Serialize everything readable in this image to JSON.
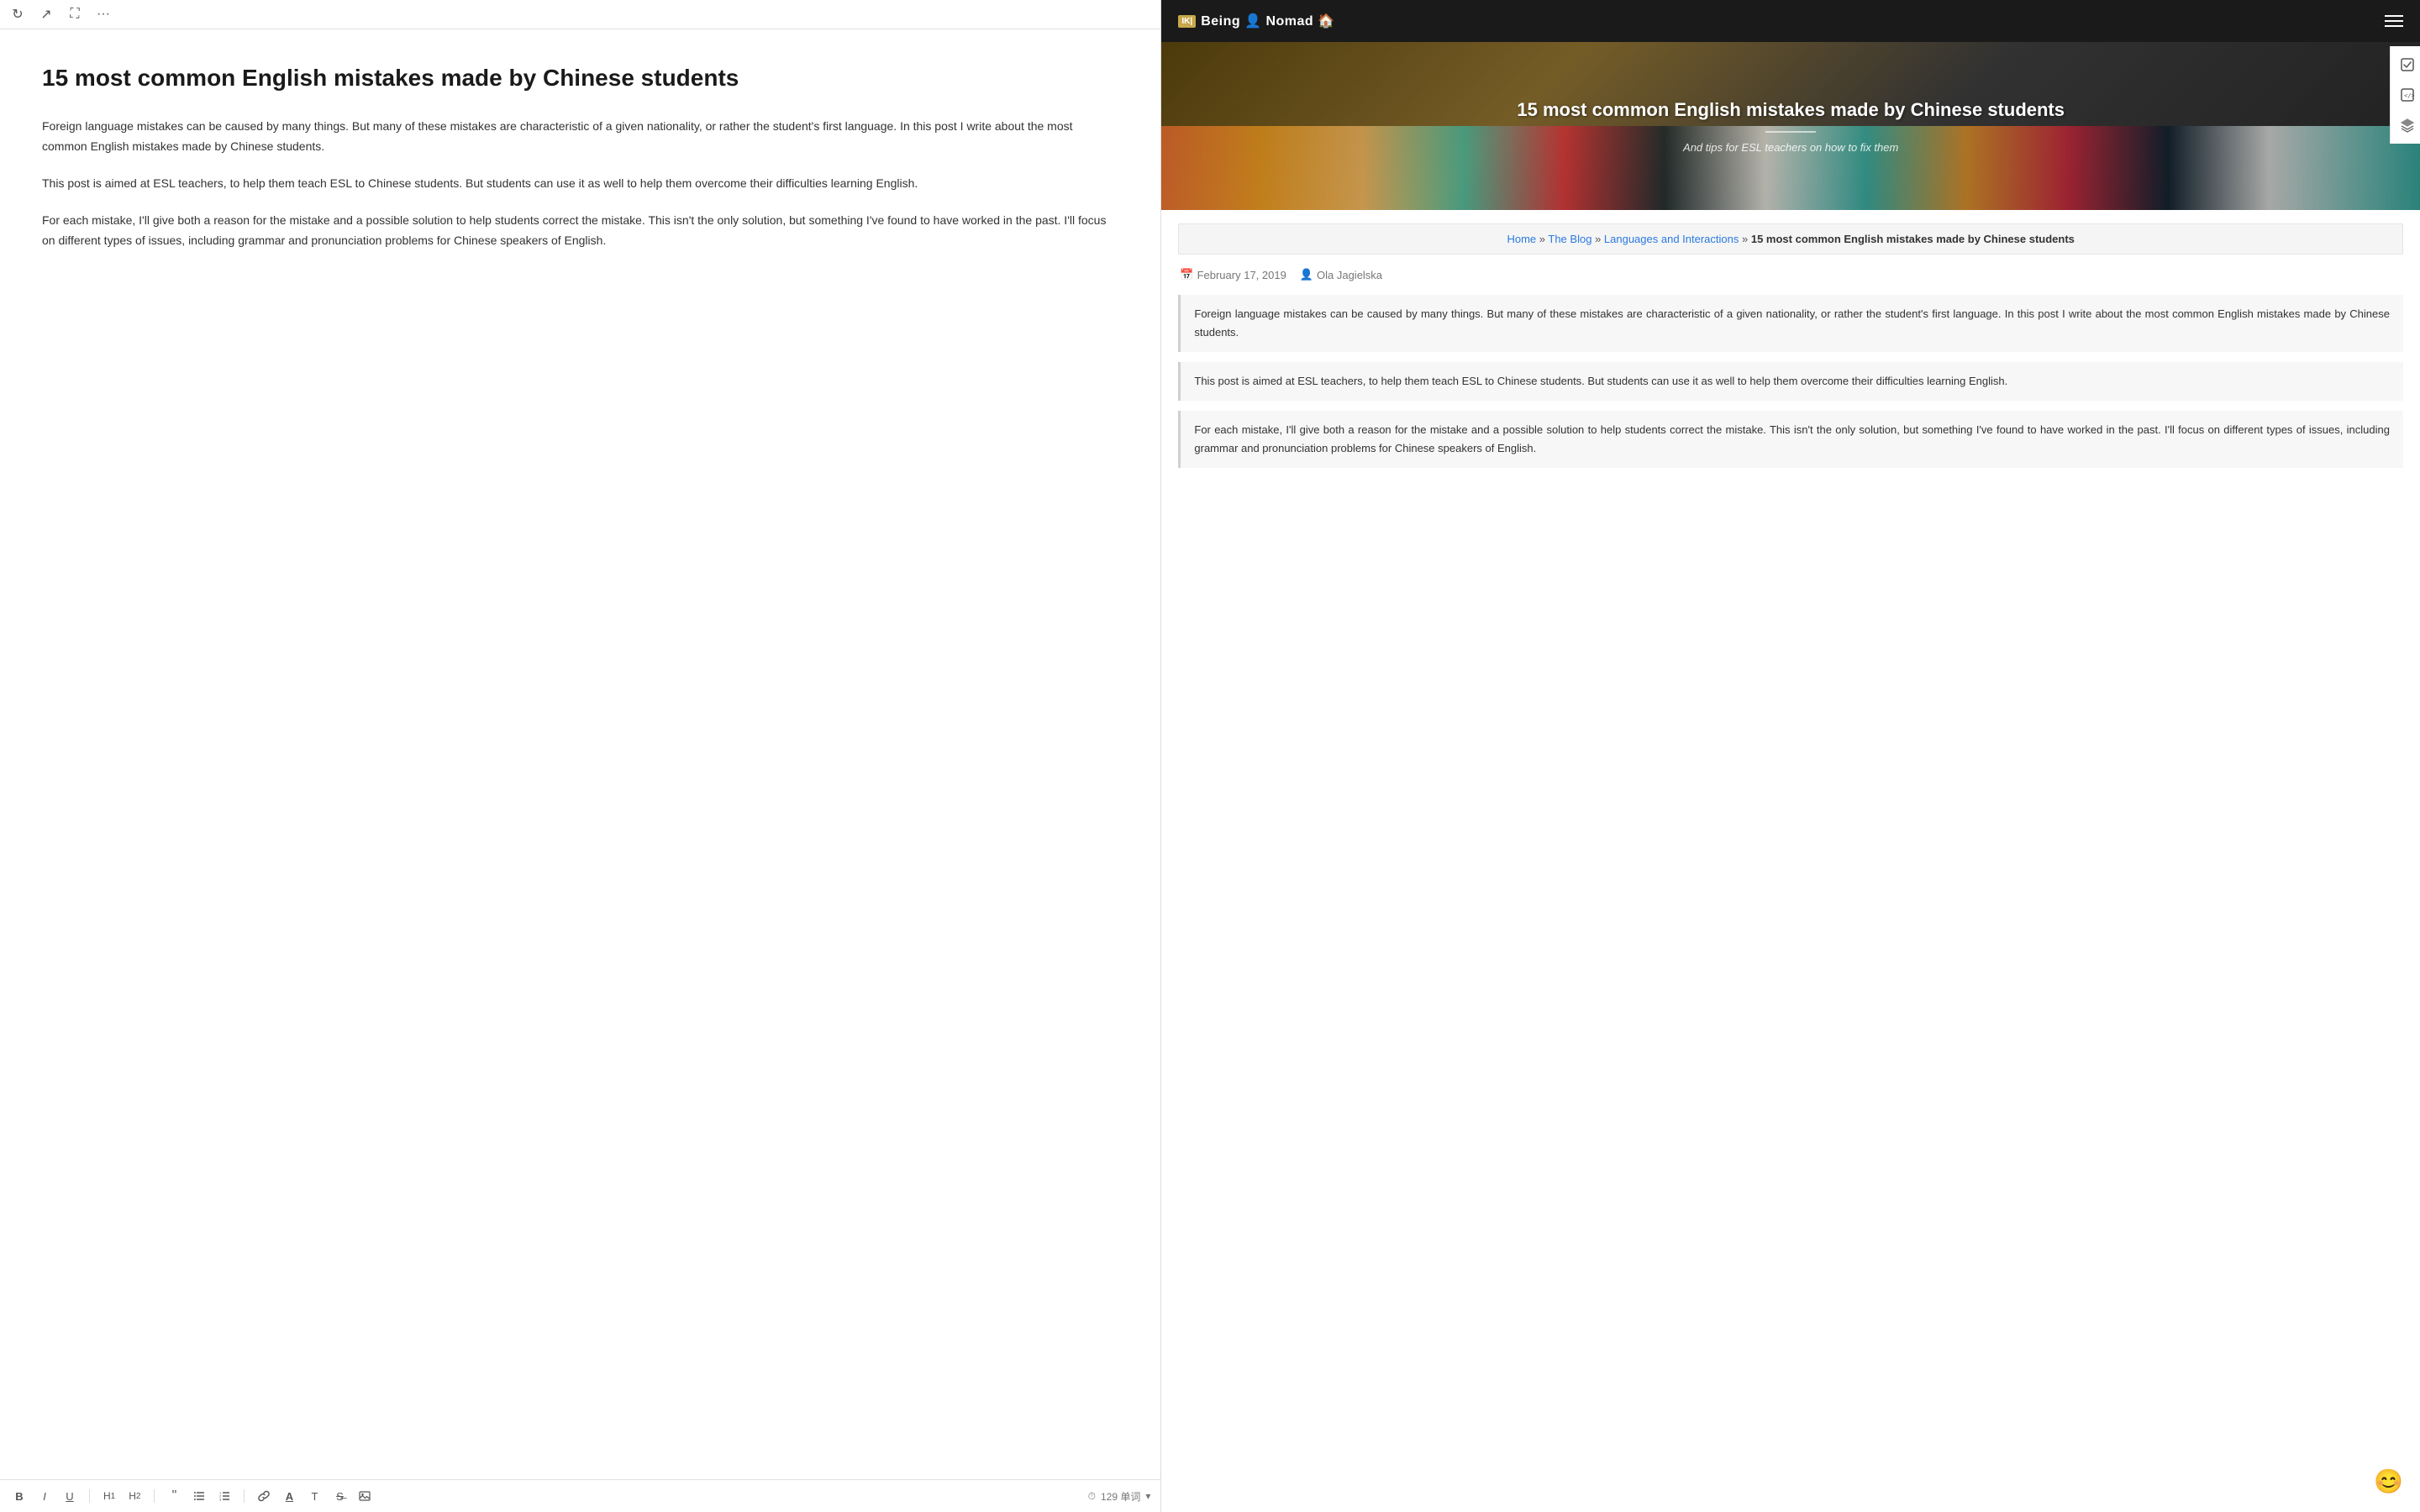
{
  "toolbar_top": {
    "refresh_icon": "↻",
    "share_icon": "↗",
    "expand_icon": "⛶",
    "more_icon": "···"
  },
  "editor": {
    "title": "15 most common English mistakes made by Chinese students",
    "paragraph1": "Foreign language mistakes can be caused by many things. But many of these mistakes are characteristic of a given nationality, or rather the student's first language. In this post I write about the most common English mistakes made by Chinese students.",
    "paragraph2": "This post is aimed at ESL teachers, to help them teach ESL to Chinese students. But students can use it as well to help them overcome their difficulties learning English.",
    "paragraph3": "For each mistake, I'll give both a reason for the mistake and a possible solution to help students correct the mistake. This isn't the only solution, but something I've found to have worked in the past. I'll focus on different types of issues, including grammar and pronunciation problems for Chinese speakers of English."
  },
  "toolbar_bottom": {
    "bold": "B",
    "italic": "I",
    "underline": "U",
    "h1": "H₁",
    "h2": "H₂",
    "quote_open": "“",
    "list_unordered": "≡",
    "list_ordered": "≡",
    "link": "🔗",
    "underline2": "A",
    "text_style": "T",
    "strikethrough": "S̶",
    "image": "🖼",
    "clock_icon": "⏱",
    "word_count": "129 单词",
    "word_count_arrow": "▾"
  },
  "site": {
    "logo_box": "IK|",
    "logo_name": "Being",
    "logo_icon": "👤",
    "logo_name2": "Nomad",
    "logo_icon2": "🏠"
  },
  "hero": {
    "title": "15 most common English mistakes made by Chinese students",
    "subtitle": "And tips for ESL teachers on how to fix them"
  },
  "breadcrumb": {
    "home": "Home",
    "separator1": "»",
    "blog": "The Blog",
    "separator2": "»",
    "category": "Languages and Interactions",
    "separator3": "»",
    "current": "15 most common English mistakes made by Chinese students"
  },
  "post_meta": {
    "date": "February 17, 2019",
    "author": "Ola Jagielska"
  },
  "article": {
    "block1": "Foreign language mistakes can be caused by many things. But many of these mistakes are characteristic of a given nationality, or rather the student's first language. In this post I write about the most common English mistakes made by Chinese students.",
    "block2": "This post is aimed at ESL teachers, to help them teach ESL to Chinese students. But students can use it as well to help them overcome their difficulties learning English.",
    "block3": "For each mistake, I'll give both a reason for the mistake and a possible solution to help students correct the mistake. This isn't the only solution, but something I've found to have worked in the past. I'll focus on different types of issues, including grammar and pronunciation problems for Chinese speakers of English."
  },
  "sidebar_icons": {
    "check_icon": "✓",
    "code_icon": "</>",
    "layers_icon": "⬛"
  },
  "bottom_emoji": "😊"
}
